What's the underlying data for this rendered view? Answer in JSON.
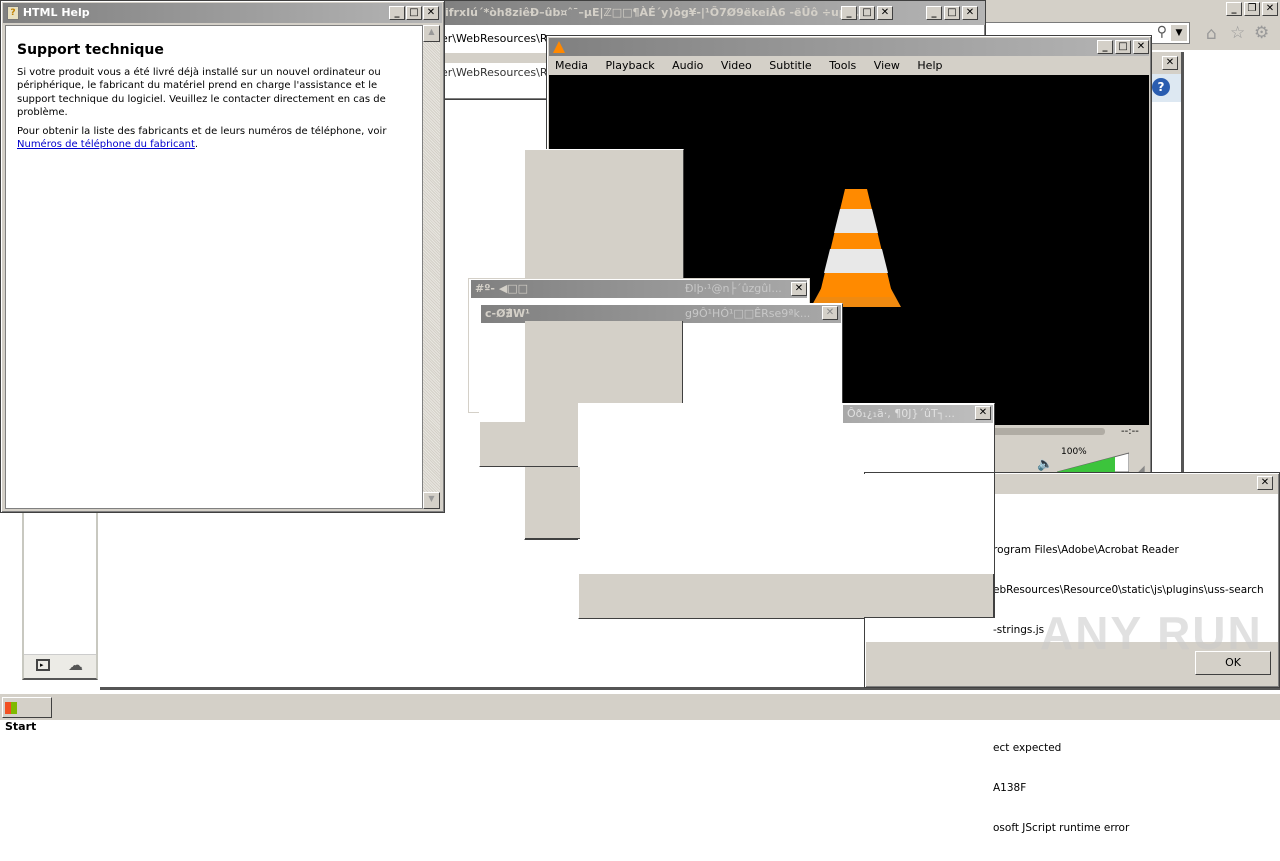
{
  "background_browser": {
    "address_fragment_1": "er\\WebResources\\Re",
    "address_fragment_2": "er\\WebResources\\Re",
    "toolbar_icons": [
      "home-icon",
      "star-icon",
      "gear-icon"
    ],
    "search_icon": "search-icon",
    "dropdown_icon": "chevron-down-icon"
  },
  "garbled_window": {
    "title": "ifrxIú´*òh8ziêÐ–ûb¤ˆ¯–µE|ℤ□□¶ÀÉ´y)ôg¥-|¹Õ7Ø9ëkeiÀ6 -ëÛô ÷up..."
  },
  "html_help": {
    "title": "HTML Help",
    "heading": "Support technique",
    "paragraph1": "Si votre produit vous a été livré déjà installé sur un nouvel ordinateur ou périphérique, le fabricant du matériel prend en charge l'assistance et le support technique du logiciel. Veuillez le contacter directement en cas de problème.",
    "paragraph2_prefix": "Pour obtenir la liste des fabricants et de leurs numéros de téléphone, voir ",
    "paragraph2_link": "Numéros de téléphone du fabricant",
    "paragraph2_suffix": "."
  },
  "vlc": {
    "title": "",
    "menu": [
      "Media",
      "Playback",
      "Audio",
      "Video",
      "Subtitle",
      "Tools",
      "View",
      "Help"
    ],
    "time": "--:--",
    "volume_label": "100%",
    "volume_level": 1.0,
    "accent": "#ff8800"
  },
  "dialog1": {
    "title_left": "#º- ◀□□",
    "title_right": "Ðlþ·¹@n├´ûzgûl..."
  },
  "dialog2": {
    "title_left": "c-Ø∄W¹",
    "title_right": "g9Ô¹HÓ¹□□ÊRse9ªk..."
  },
  "dialog3": {
    "title": "Ôð₁¿₁ä·, ¶0J}´ûT┐..."
  },
  "script_error": {
    "lines": [
      "rogram Files\\Adobe\\Acrobat Reader",
      "ebResources\\Resource0\\static\\js\\plugins\\uss-search",
      "-strings.js",
      "",
      "ect expected",
      "A138F",
      "osoft JScript runtime error"
    ],
    "ok_label": "OK"
  },
  "left_panel": {
    "icons": [
      "terminal-icon",
      "cloud-icon"
    ]
  },
  "taskbar": {
    "start_label": "Start"
  },
  "watermark": "ANY RUN"
}
